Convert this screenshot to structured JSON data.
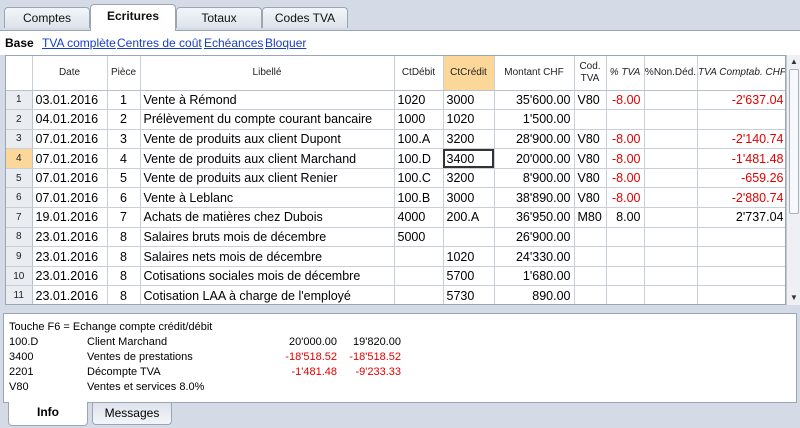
{
  "tabs": [
    "Comptes",
    "Ecritures",
    "Totaux",
    "Codes TVA"
  ],
  "subbar": {
    "current": "Base",
    "links": [
      "TVA complète",
      "Centres de coût",
      "Echéances",
      "Bloquer"
    ]
  },
  "columns": [
    "",
    "Date",
    "Pièce",
    "Libellé",
    "CtDébit",
    "CtCrédit",
    "Montant CHF",
    "Cod. TVA",
    "% TVA",
    "%Non.Déd.",
    "TVA Comptab. CHF"
  ],
  "rows": [
    {
      "n": "1",
      "date": "03.01.2016",
      "piece": "1",
      "libelle": "Vente à Rémond",
      "debit": "1020",
      "credit": "3000",
      "montant": "35'600.00",
      "code": "V80",
      "pct": "-8.00",
      "nondeduct": "",
      "tva": "-2'637.04"
    },
    {
      "n": "2",
      "date": "04.01.2016",
      "piece": "2",
      "libelle": "Prélèvement du compte courant bancaire",
      "debit": "1000",
      "credit": "1020",
      "montant": "1'500.00",
      "code": "",
      "pct": "",
      "nondeduct": "",
      "tva": ""
    },
    {
      "n": "3",
      "date": "07.01.2016",
      "piece": "3",
      "libelle": "Vente de produits aux client Dupont",
      "debit": "100.A",
      "credit": "3200",
      "montant": "28'900.00",
      "code": "V80",
      "pct": "-8.00",
      "nondeduct": "",
      "tva": "-2'140.74"
    },
    {
      "n": "4",
      "date": "07.01.2016",
      "piece": "4",
      "libelle": "Vente de produits aux client Marchand",
      "debit": "100.D",
      "credit": "3400",
      "montant": "20'000.00",
      "code": "V80",
      "pct": "-8.00",
      "nondeduct": "",
      "tva": "-1'481.48"
    },
    {
      "n": "5",
      "date": "07.01.2016",
      "piece": "5",
      "libelle": "Vente de produits aux client Renier",
      "debit": "100.C",
      "credit": "3200",
      "montant": "8'900.00",
      "code": "V80",
      "pct": "-8.00",
      "nondeduct": "",
      "tva": "-659.26"
    },
    {
      "n": "6",
      "date": "07.01.2016",
      "piece": "6",
      "libelle": "Vente à Leblanc",
      "debit": "100.B",
      "credit": "3000",
      "montant": "38'890.00",
      "code": "V80",
      "pct": "-8.00",
      "nondeduct": "",
      "tva": "-2'880.74"
    },
    {
      "n": "7",
      "date": "19.01.2016",
      "piece": "7",
      "libelle": "Achats de matières chez Dubois",
      "debit": "4000",
      "credit": "200.A",
      "montant": "36'950.00",
      "code": "M80",
      "pct": "8.00",
      "nondeduct": "",
      "tva": "2'737.04"
    },
    {
      "n": "8",
      "date": "23.01.2016",
      "piece": "8",
      "libelle": "Salaires bruts mois de décembre",
      "debit": "5000",
      "credit": "",
      "montant": "26'900.00",
      "code": "",
      "pct": "",
      "nondeduct": "",
      "tva": ""
    },
    {
      "n": "9",
      "date": "23.01.2016",
      "piece": "8",
      "libelle": "Salaires nets mois de décembre",
      "debit": "",
      "credit": "1020",
      "montant": "24'330.00",
      "code": "",
      "pct": "",
      "nondeduct": "",
      "tva": ""
    },
    {
      "n": "10",
      "date": "23.01.2016",
      "piece": "8",
      "libelle": "Cotisations sociales mois de décembre",
      "debit": "",
      "credit": "5700",
      "montant": "1'680.00",
      "code": "",
      "pct": "",
      "nondeduct": "",
      "tva": ""
    },
    {
      "n": "11",
      "date": "23.01.2016",
      "piece": "8",
      "libelle": "Cotisation LAA à charge de l'employé",
      "debit": "",
      "credit": "5730",
      "montant": "890.00",
      "code": "",
      "pct": "",
      "nondeduct": "",
      "tva": ""
    }
  ],
  "info": {
    "hint": "Touche F6 = Echange compte crédit/débit",
    "lines": [
      {
        "account": "100.D",
        "label": "Client Marchand",
        "amount": "20'000.00",
        "balance": "19'820.00"
      },
      {
        "account": "3400",
        "label": "Ventes de prestations",
        "amount": "-18'518.52",
        "balance": "-18'518.52"
      },
      {
        "account": "2201",
        "label": "Décompte TVA",
        "amount": "-1'481.48",
        "balance": "-9'233.33"
      },
      {
        "account": "V80",
        "label": "Ventes et services 8.0%",
        "amount": "",
        "balance": ""
      }
    ]
  },
  "bottom_tabs": [
    "Info",
    "Messages"
  ]
}
